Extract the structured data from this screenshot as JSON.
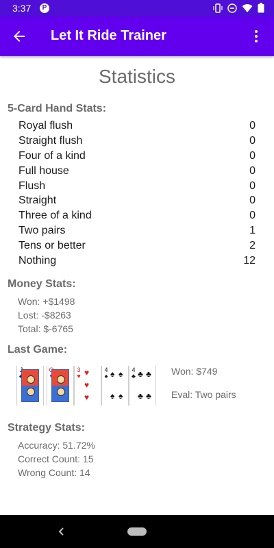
{
  "status_bar": {
    "time": "3:37",
    "app_icon_letter": "P"
  },
  "app_bar": {
    "title": "Let It Ride Trainer",
    "color": "#6200ee",
    "status_color": "#4f0fd6"
  },
  "page": {
    "title": "Statistics"
  },
  "hand_stats": {
    "title": "5-Card Hand Stats:",
    "rows": [
      {
        "label": "Royal flush",
        "value": "0"
      },
      {
        "label": "Straight flush",
        "value": "0"
      },
      {
        "label": "Four of a kind",
        "value": "0"
      },
      {
        "label": "Full house",
        "value": "0"
      },
      {
        "label": "Flush",
        "value": "0"
      },
      {
        "label": "Straight",
        "value": "0"
      },
      {
        "label": "Three of a kind",
        "value": "0"
      },
      {
        "label": "Two pairs",
        "value": "1"
      },
      {
        "label": "Tens or better",
        "value": "2"
      },
      {
        "label": "Nothing",
        "value": "12"
      }
    ]
  },
  "money_stats": {
    "title": "Money Stats:",
    "won": "Won: +$1498",
    "lost": "Lost: -$8263",
    "total": "Total: $-6765"
  },
  "last_game": {
    "title": "Last Game:",
    "cards": [
      {
        "rank": "J",
        "suit": "♣",
        "color": "black"
      },
      {
        "rank": "Q",
        "suit": "♥",
        "color": "red"
      },
      {
        "rank": "3",
        "suit": "♥",
        "color": "red"
      },
      {
        "rank": "4",
        "suit": "♠",
        "color": "black"
      },
      {
        "rank": "4",
        "suit": "♣",
        "color": "black"
      }
    ],
    "won": "Won: $749",
    "eval": "Eval: Two pairs"
  },
  "strategy_stats": {
    "title": "Strategy Stats:",
    "accuracy": "Accuracy: 51.72%",
    "correct": "Correct Count: 15",
    "wrong": "Wrong Count: 14"
  }
}
